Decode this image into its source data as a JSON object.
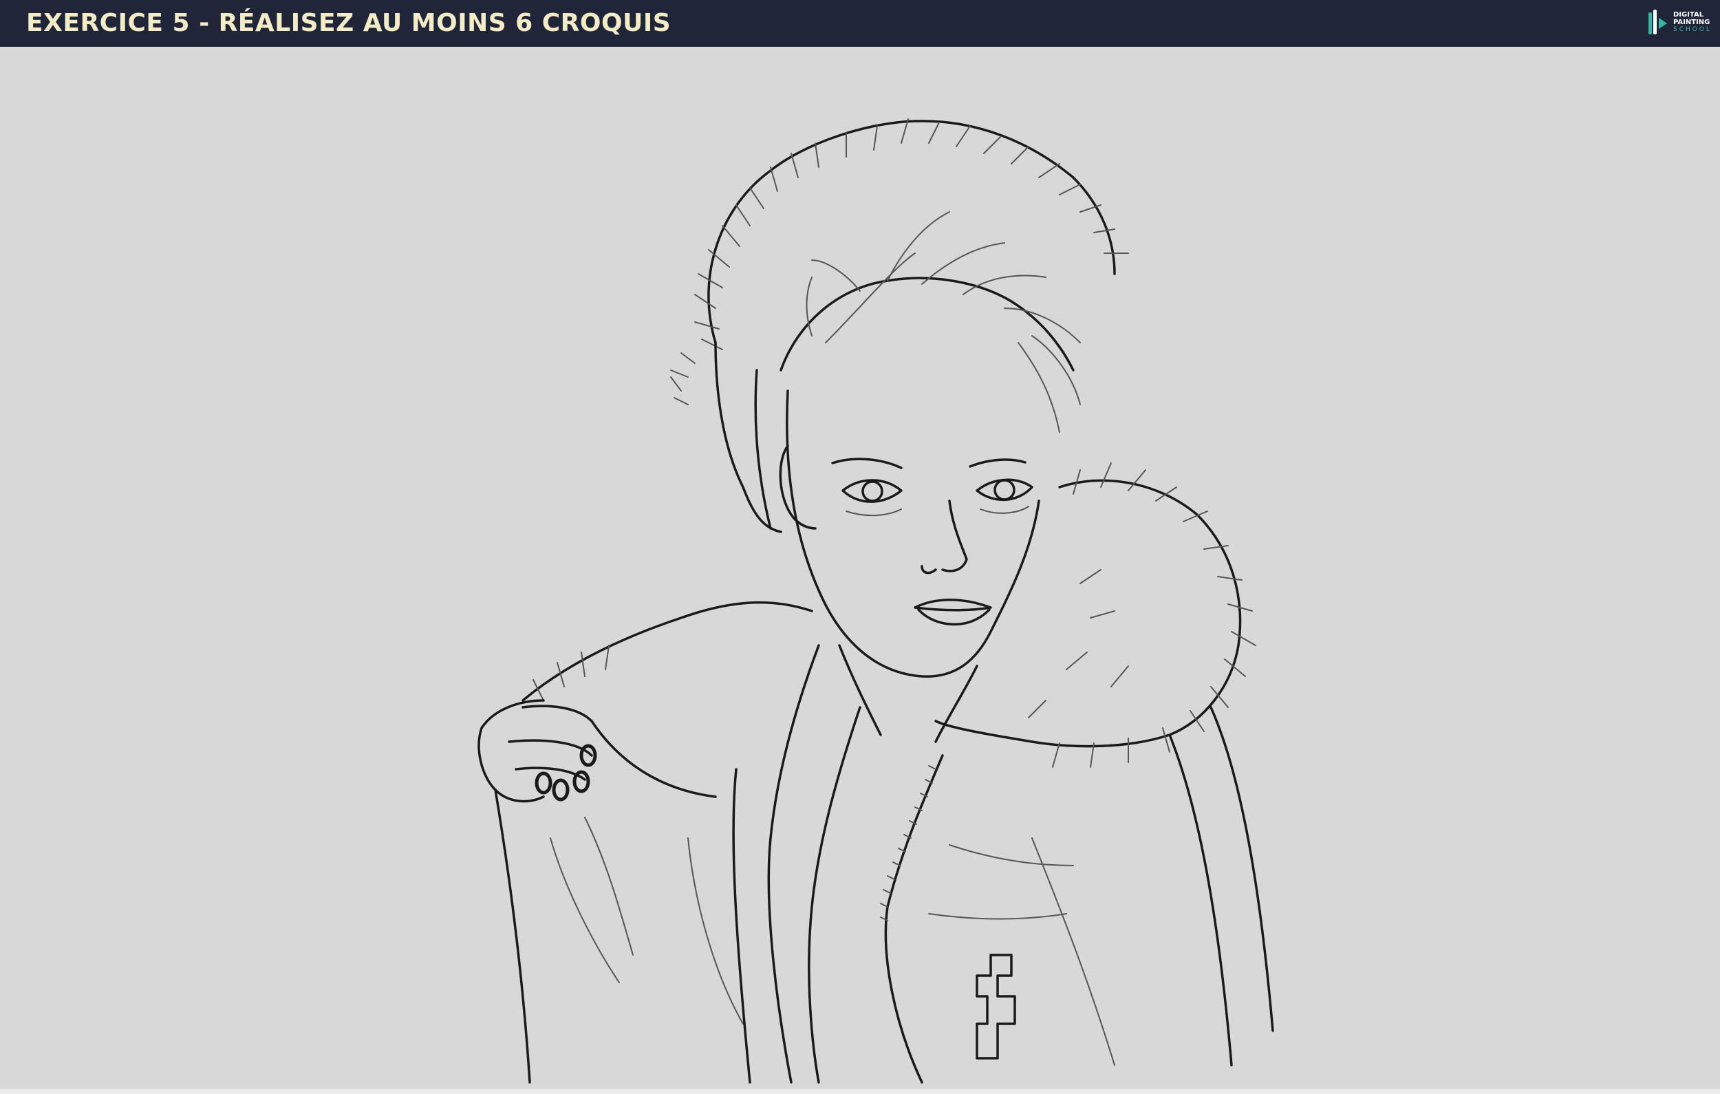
{
  "header": {
    "title": "EXERCICE 5 - RÉALISEZ AU MOINS 6 CROQUIS",
    "background_color": "#1f263a",
    "title_color": "#f3ecc5"
  },
  "logo": {
    "line1": "DIGITAL",
    "line2": "PAINTING",
    "line3": "SCHOOL",
    "accent_color": "#31b7a4"
  },
  "canvas": {
    "background_color": "#d8d8d8",
    "content": "line-art-sketch"
  }
}
